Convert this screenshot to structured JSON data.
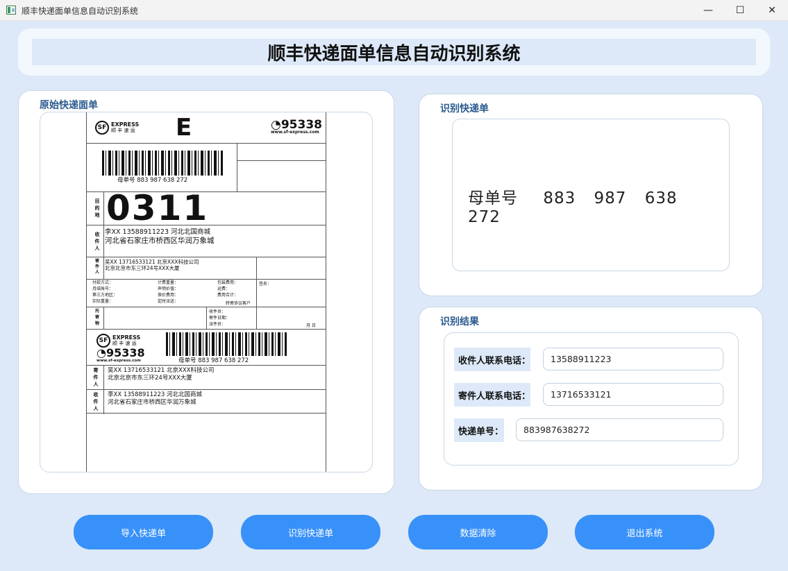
{
  "window": {
    "title": "顺丰快递面单信息自动识别系统",
    "minimize_glyph": "—",
    "maximize_glyph": "☐",
    "close_glyph": "✕"
  },
  "header": {
    "title": "顺丰快递面单信息自动识别系统"
  },
  "original_panel": {
    "label": "原始快递面单",
    "waybill": {
      "express_text": "EXPRESS",
      "brand_cn": "顺 丰 速 运",
      "sf_mark": "SF",
      "letter": "E",
      "hotline": "◔95338",
      "website": "www.sf-express.com",
      "master_label": "母单号   883  987  638  272",
      "dest_label": "目的地",
      "dest_code": "0311",
      "receiver_label": "收件人",
      "receiver_line1": "李XX    13588911223  河北北国商城",
      "receiver_line2": "河北省石家庄市桥西区华润万象城",
      "sender_label": "寄件人",
      "sender_line1": "吴XX    13716533121  北京XXX科技公司",
      "sender_line2": "北京北京市东三环24号XXX大厦",
      "pay_col1": [
        "付款方式：",
        "月结账号：",
        "第三方地区：",
        "实际重量："
      ],
      "pay_col2": [
        "计费重量：",
        "声明价值：",
        "保价费用：",
        "定时派送："
      ],
      "pay_col3": [
        "包装费用：",
        "运费：",
        "费用合计："
      ],
      "signature": "签名：",
      "transfer_customer": "转寄协议客户",
      "goods_label": "托寄物",
      "collector": [
        "收件员：",
        "寄件日期：",
        "派件员："
      ],
      "month_day": "月    日",
      "lower_hotline": "◔95338",
      "lower_website": "www.sf-express.com",
      "lower_master_label": "母单号   883  987  638  272",
      "lower_sender_label": "寄件人",
      "lower_sender_line1": "吴XX    13716533121  北京XXX科技公司",
      "lower_sender_line2": "北京北京市东三环24号XXX大厦",
      "lower_receiver_label": "收件人",
      "lower_receiver_line1": "李XX    13588911223  河北北国商城",
      "lower_receiver_line2": "河北省石家庄市桥西区华润万象城"
    }
  },
  "recognized_panel": {
    "label": "识别快递单",
    "prefix": "母单号",
    "groups": [
      "883",
      "987",
      "638",
      "272"
    ]
  },
  "result_panel": {
    "label": "识别结果",
    "receiver_phone_label": "收件人联系电话：",
    "receiver_phone_value": "13588911223",
    "sender_phone_label": "寄件人联系电话：",
    "sender_phone_value": "13716533121",
    "tracking_label": "快递单号：",
    "tracking_value": "883987638272"
  },
  "buttons": {
    "import": "导入快递单",
    "recognize": "识别快递单",
    "clear": "数据清除",
    "exit": "退出系统"
  },
  "colors": {
    "background": "#dde9f8",
    "accent": "#3891f8",
    "label_text": "#2a5a8e"
  }
}
